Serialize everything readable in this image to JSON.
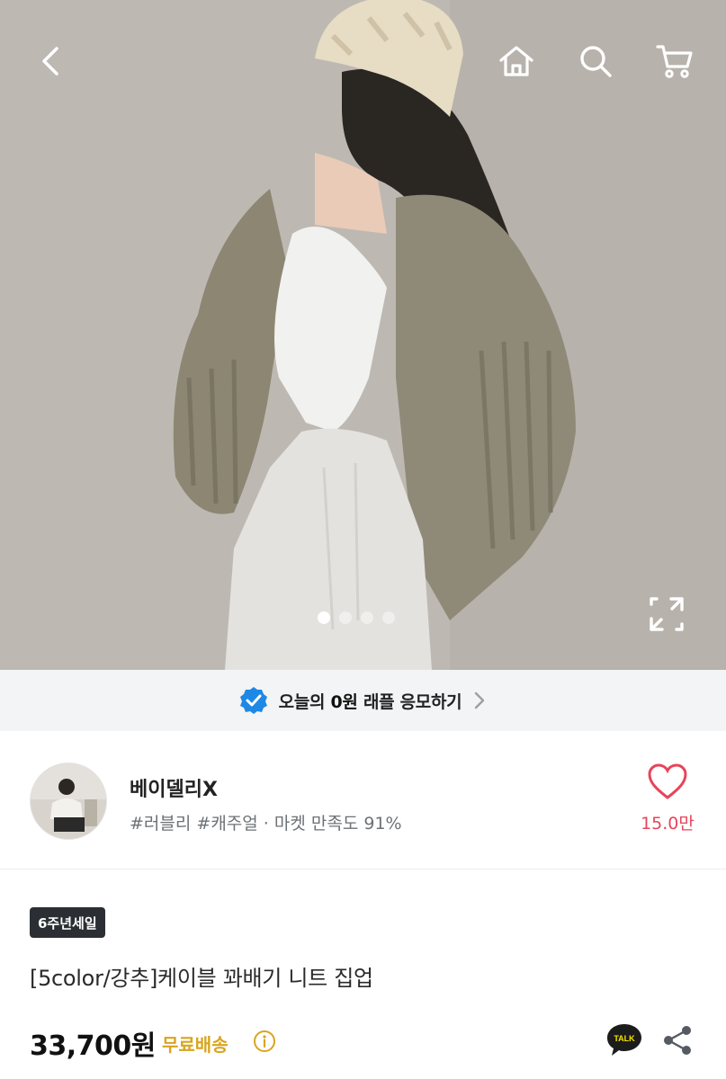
{
  "header": {
    "back_icon": "chevron-left-icon",
    "home_icon": "home-icon",
    "search_icon": "search-icon",
    "cart_icon": "cart-icon"
  },
  "gallery": {
    "image_count": 4,
    "current_index": 1,
    "expand_icon": "expand-icon"
  },
  "raffle_banner": {
    "text_before": "오늘의 ",
    "text_bold": "0원",
    "text_after": " 래플 응모하기",
    "check_icon": "verified-check-icon",
    "chevron_icon": "chevron-right-icon",
    "accent_color": "#1e88e5"
  },
  "store": {
    "name": "베이델리X",
    "tags": "#러블리 #캐주얼 · 마켓 만족도 91%",
    "like_count": "15.0만",
    "like_icon": "heart-icon",
    "like_color": "#e8445a"
  },
  "product": {
    "badge": "6주년세일",
    "title": "[5color/강추]케이블 꽈배기 니트 집업",
    "price": "33,700원",
    "shipping": "무료배송",
    "shipping_color": "#d8a51f",
    "info_icon": "info-icon",
    "talk_label": "TALK",
    "talk_icon": "kakao-talk-icon",
    "share_icon": "share-icon"
  }
}
